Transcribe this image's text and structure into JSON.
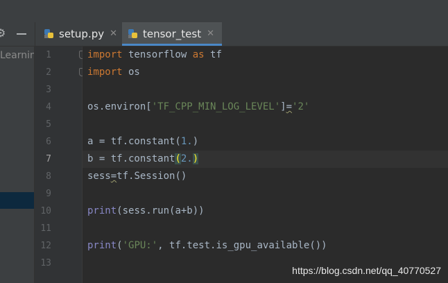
{
  "project_panel": {
    "tree_text": "Learnin"
  },
  "tabs": [
    {
      "label": "setup.py",
      "active": false,
      "icon": "python-file-icon"
    },
    {
      "label": "tensor_test",
      "active": true,
      "icon": "python-file-icon"
    }
  ],
  "tab_close_glyph": "✕",
  "gutter": {
    "line_numbers": [
      "1",
      "2",
      "3",
      "4",
      "5",
      "6",
      "7",
      "8",
      "9",
      "10",
      "11",
      "12",
      "13"
    ],
    "current_line": "7"
  },
  "code": {
    "l1": {
      "kw1": "import",
      "t1": " tensorflow ",
      "kw2": "as",
      "t2": " tf"
    },
    "l2": {
      "kw1": "import",
      "t1": " os"
    },
    "l4": {
      "t1": "os.environ[",
      "s1": "'TF_CPP_MIN_LOG_LEVEL'",
      "t2": "]",
      "t3": "=",
      "s2": "'2'"
    },
    "l6": {
      "t1": "a = tf.constant(",
      "n1": "1.",
      "t2": ")"
    },
    "l7": {
      "t1": "b = tf.constant",
      "p1": "(",
      "n1": "2.",
      "p2": ")"
    },
    "l8": {
      "t1": "sess",
      "t2": "=",
      "t3": "tf.Session()"
    },
    "l10": {
      "b1": "print",
      "t1": "(sess.run(a+b))"
    },
    "l12": {
      "b1": "print",
      "t1": "(",
      "s1": "'GPU:'",
      "t2": ", tf.test.is_gpu_available())"
    }
  },
  "watermark": "https://blog.csdn.net/qq_40770527",
  "colors": {
    "keyword": "#cc7832",
    "string": "#6a8759",
    "number": "#6897bb",
    "builtin": "#8888c6",
    "active_tab_underline": "#4a88c7"
  }
}
